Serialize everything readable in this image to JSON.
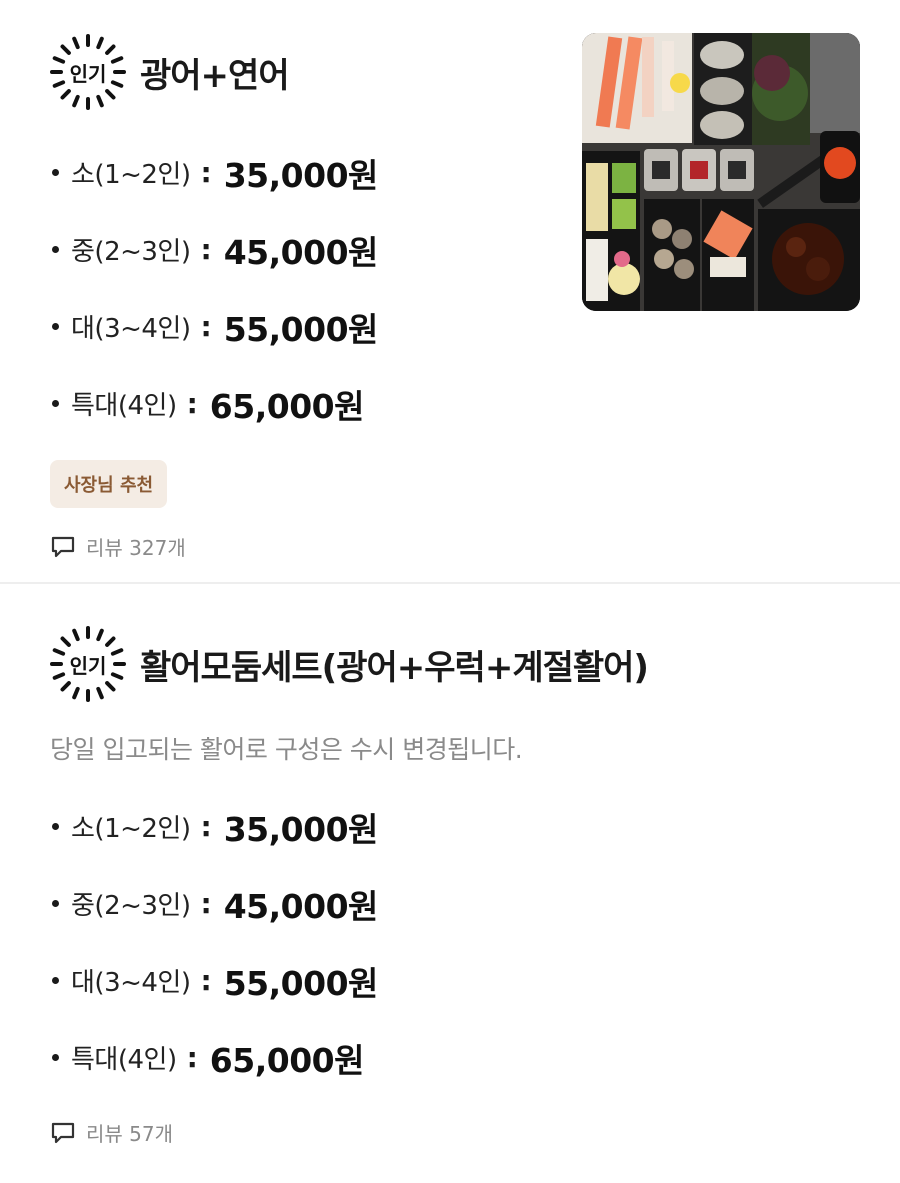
{
  "items": [
    {
      "badge": "인기",
      "title": "광어+연어",
      "prices": [
        {
          "size": "소(1~2인)",
          "price": "35,000원"
        },
        {
          "size": "중(2~3인)",
          "price": "45,000원"
        },
        {
          "size": "대(3~4인)",
          "price": "55,000원"
        },
        {
          "size": "특대(4인)",
          "price": "65,000원"
        }
      ],
      "tag": "사장님 추천",
      "reviews": "리뷰 327개",
      "image_icon": "sashimi-platter-photo"
    },
    {
      "badge": "인기",
      "title": "활어모둠세트(광어+우럭+계절활어)",
      "description": "당일 입고되는 활어로 구성은 수시 변경됩니다.",
      "prices": [
        {
          "size": "소(1~2인)",
          "price": "35,000원"
        },
        {
          "size": "중(2~3인)",
          "price": "45,000원"
        },
        {
          "size": "대(3~4인)",
          "price": "55,000원"
        },
        {
          "size": "특대(4인)",
          "price": "65,000원"
        }
      ],
      "reviews": "리뷰 57개"
    }
  ],
  "colon": ":",
  "colors": {
    "tag_bg": "#f4ece4",
    "tag_text": "#8a5a34",
    "muted": "#8a8a8a"
  },
  "icons": {
    "badge": "starburst-badge-icon",
    "review": "speech-bubble-icon"
  }
}
